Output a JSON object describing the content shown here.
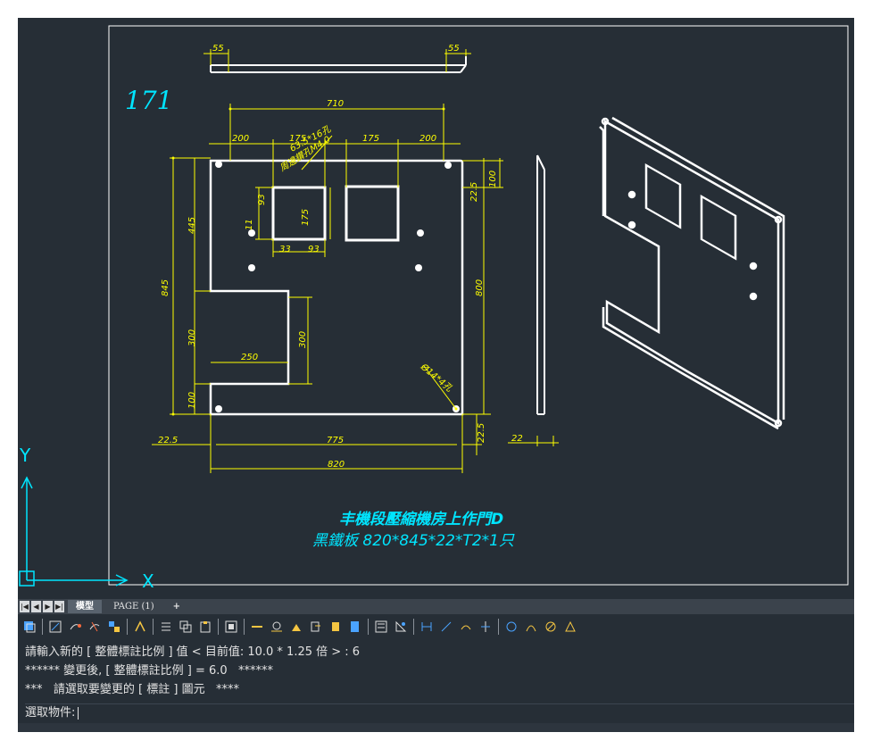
{
  "drawing": {
    "sheet_number": "171",
    "title_line1": "丰機段壓縮機房上作門D",
    "title_line2": "黑鐵板 820*845*22*T2*1只",
    "dimensions": {
      "top_left_flange": "55",
      "top_right_flange": "55",
      "overall_top": "710",
      "seg_200_left": "200",
      "seg_175_a": "175",
      "seg_175_b": "175",
      "seg_200_right": "200",
      "note_holes": "63.5*16孔",
      "note_bolt": "周邊鑽孔M4.0",
      "right_100": "100",
      "right_22_5": "22.5",
      "left_445": "445",
      "left_845": "845",
      "left_300": "300",
      "left_100": "100",
      "right_800": "800",
      "notch_300": "300",
      "notch_250": "250",
      "window_175": "175",
      "window_93": "93",
      "window_93_b": "93",
      "window_33": "33",
      "window_11": "11",
      "hole_note": "Ø14*4孔",
      "bottom_22_5": "22.5",
      "bottom_775": "775",
      "bottom_820": "820",
      "bottom_right_22_5": "22.5",
      "side_22": "22"
    },
    "ucs": {
      "x_label": "X",
      "y_label": "Y"
    },
    "colors": {
      "background": "#262e36",
      "geometry": "#ffffff",
      "dimension": "#ffff00",
      "annotation": "#00e5ff"
    }
  },
  "layout_tabs": {
    "nav_buttons": [
      "|◀",
      "◀",
      "▶",
      "▶|"
    ],
    "tabs": [
      {
        "label": "模型",
        "active": true
      },
      {
        "label": "PAGE (1)",
        "active": false
      }
    ],
    "add_label": "+"
  },
  "toolbar": {
    "icons": [
      "layers-icon",
      "match-icon",
      "link-icon",
      "unlink-icon",
      "block-icon",
      "text-icon",
      "list-icon",
      "copy-icon",
      "paste-icon",
      "quick-dim-icon",
      "linear-dim-icon",
      "aligned-dim-icon",
      "arc-dim-icon",
      "ordinate-dim-icon",
      "radius-dim-icon",
      "jogged-dim-icon",
      "diameter-dim-icon",
      "angular-dim-icon",
      "baseline-dim-icon",
      "continue-dim-icon",
      "space-dim-icon",
      "break-dim-icon",
      "leader-icon",
      "tolerance-icon",
      "center-mark-icon",
      "inspect-icon"
    ]
  },
  "command": {
    "history": [
      "請輸入新的 [ 整體標註比例 ] 值 < 目前值: 10.0 * 1.25 倍 > : 6",
      "****** 變更後, [ 整體標註比例 ] = 6.0   ******",
      "***   請選取要變更的 [ 標註 ] 圖元   ****"
    ],
    "prompt": "選取物件:"
  }
}
